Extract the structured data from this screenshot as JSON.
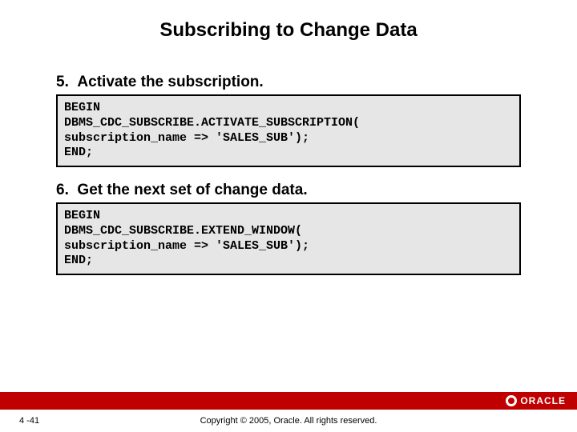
{
  "title": "Subscribing to Change Data",
  "steps": [
    {
      "num": "5.",
      "label": "Activate the subscription.",
      "code": "BEGIN\nDBMS_CDC_SUBSCRIBE.ACTIVATE_SUBSCRIPTION(\nsubscription_name => 'SALES_SUB');\nEND;"
    },
    {
      "num": "6.",
      "label": "Get the next set of change data.",
      "code": "BEGIN\nDBMS_CDC_SUBSCRIBE.EXTEND_WINDOW(\nsubscription_name => 'SALES_SUB');\nEND;"
    }
  ],
  "logo_text": "ORACLE",
  "page_number": "4 -41",
  "copyright": "Copyright © 2005, Oracle.  All rights reserved."
}
